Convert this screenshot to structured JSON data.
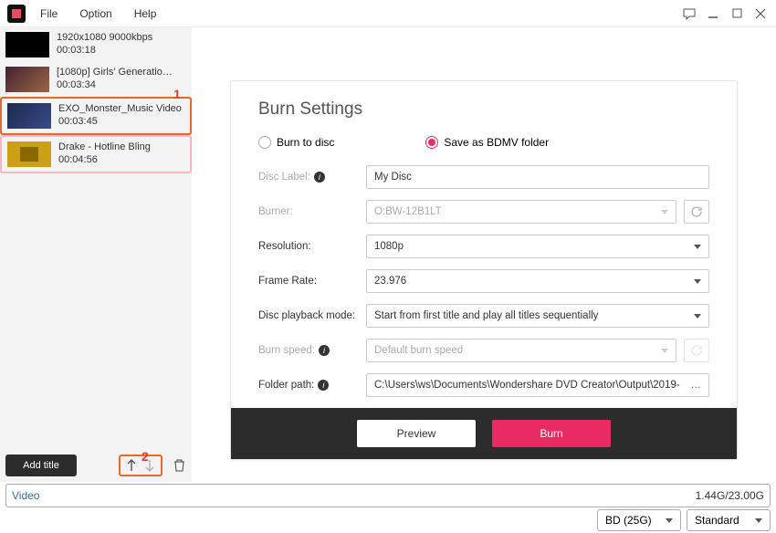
{
  "menu": {
    "file": "File",
    "option": "Option",
    "help": "Help"
  },
  "videos": [
    {
      "title": "1920x1080 9000kbps",
      "duration": "00:03:18"
    },
    {
      "title": "[1080p] Girls' Generatio…",
      "duration": "00:03:34"
    },
    {
      "title": "EXO_Monster_Music Video",
      "duration": "00:03:45"
    },
    {
      "title": "Drake - Hotline Bling",
      "duration": "00:04:56"
    }
  ],
  "annotations": {
    "a1": "1",
    "a2": "2"
  },
  "sidebar": {
    "add_title": "Add title"
  },
  "panel": {
    "title": "Burn Settings",
    "radio": {
      "burn_to_disc": "Burn to disc",
      "save_bdmv": "Save as BDMV folder"
    },
    "labels": {
      "disc_label": "Disc Label:",
      "burner": "Burner:",
      "resolution": "Resolution:",
      "frame_rate": "Frame Rate:",
      "playback_mode": "Disc playback mode:",
      "burn_speed": "Burn speed:",
      "folder_path": "Folder path:"
    },
    "values": {
      "disc_label": "My Disc",
      "burner": "O:BW-12B1LT",
      "resolution": "1080p",
      "frame_rate": "23.976",
      "playback_mode": "Start from first title and play all titles sequentially",
      "burn_speed": "Default burn speed",
      "folder_path": "C:\\Users\\ws\\Documents\\Wondershare DVD Creator\\Output\\2019-"
    },
    "buttons": {
      "preview": "Preview",
      "burn": "Burn"
    }
  },
  "status": {
    "label": "Video",
    "size": "1.44G/23.00G"
  },
  "bottom": {
    "disc_type": "BD (25G)",
    "quality": "Standard"
  }
}
